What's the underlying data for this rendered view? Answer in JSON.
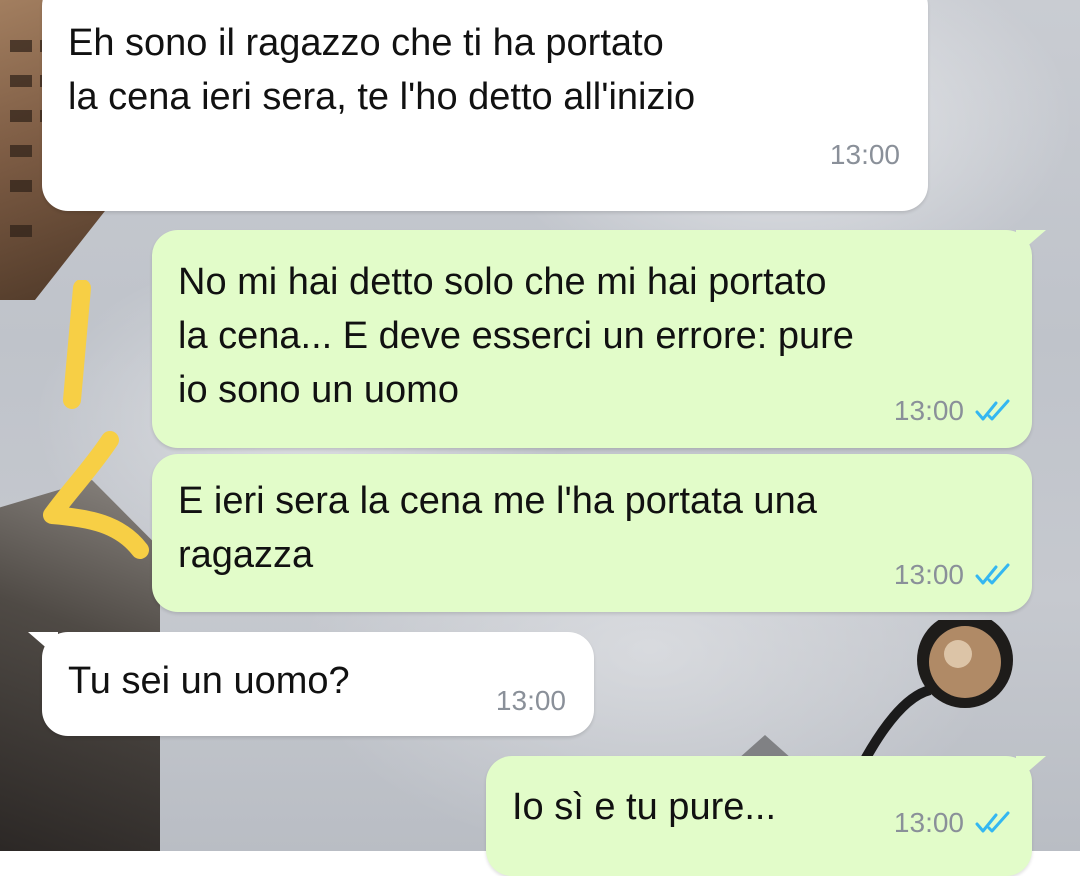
{
  "chat": {
    "messages": [
      {
        "direction": "incoming",
        "text": "Eh sono il ragazzo che ti ha portato\nla cena ieri sera, te l'ho detto all'inizio",
        "time": "13:00"
      },
      {
        "direction": "outgoing",
        "text": "No mi hai detto solo che mi hai portato\nla cena... E deve esserci un errore: pure\nio sono un uomo",
        "time": "13:00",
        "status_icon": "double-check-read-icon"
      },
      {
        "direction": "outgoing",
        "text": "E ieri sera la cena me l'ha portata una\nragazza",
        "time": "13:00",
        "status_icon": "double-check-read-icon"
      },
      {
        "direction": "incoming",
        "text": "Tu sei un uomo?",
        "time": "13:00"
      },
      {
        "direction": "outgoing",
        "text": "Io sì e tu pure...",
        "time": "13:00",
        "status_icon": "double-check-read-icon"
      }
    ]
  },
  "colors": {
    "incoming_bubble": "#ffffff",
    "outgoing_bubble": "#e2fcc9",
    "timestamp": "#8a9099",
    "read_ticks": "#34b7f1",
    "scribble": "#f7cf45"
  },
  "annotation": {
    "text": "4"
  }
}
